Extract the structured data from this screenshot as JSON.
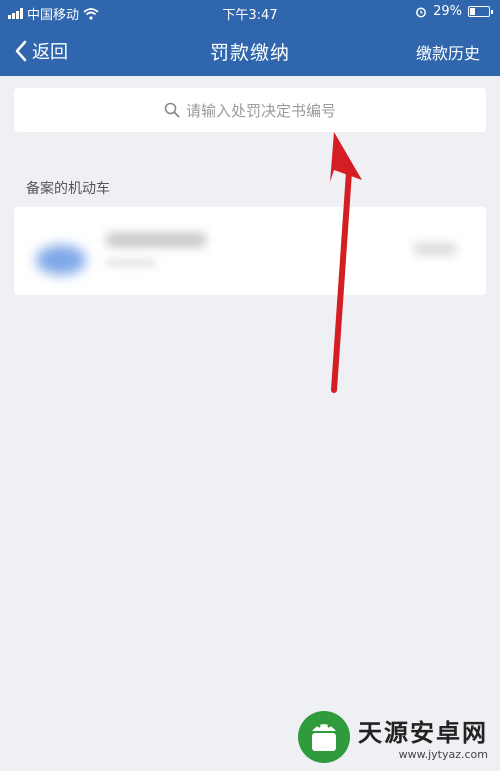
{
  "status_bar": {
    "carrier": "中国移动",
    "time": "下午3:47",
    "battery": "29%",
    "battery_level": 0.29
  },
  "nav": {
    "back_label": "返回",
    "title": "罚款缴纳",
    "history_label": "缴款历史"
  },
  "search": {
    "placeholder": "请输入处罚决定书编号"
  },
  "section": {
    "label": "备案的机动车"
  },
  "annotation": {
    "arrow_color": "#d41e24"
  },
  "watermark": {
    "name": "天源安卓网",
    "url": "www.jytyaz.com"
  },
  "colors": {
    "header_bg": "#2f66ad",
    "page_bg": "#eff0f4",
    "logo_green": "#2f9b3c"
  }
}
